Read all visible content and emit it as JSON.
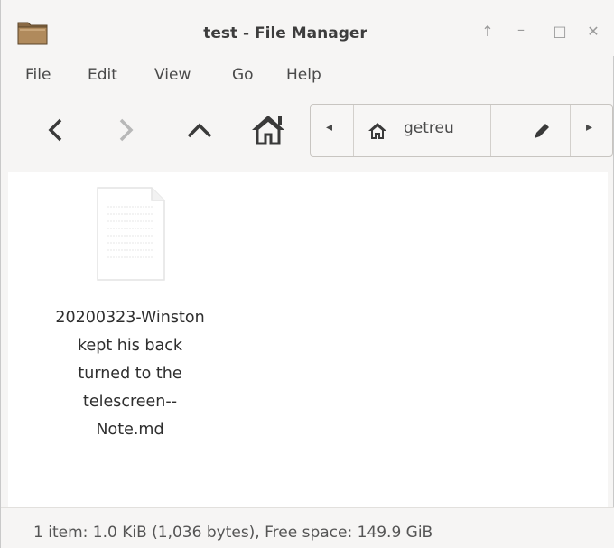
{
  "window": {
    "title": "test - File Manager",
    "controls": [
      "↑",
      "–",
      "□",
      "✕"
    ]
  },
  "menu": {
    "items": [
      "File",
      "Edit",
      "View",
      "Go",
      "Help"
    ]
  },
  "toolbar": {
    "back_icon": "chevron-left-icon",
    "forward_icon": "chevron-right-icon",
    "up_icon": "chevron-up-icon",
    "home_icon": "home-icon"
  },
  "pathbar": {
    "location": "getreu",
    "left_arrow": "◂",
    "right_arrow": "▸",
    "edit_icon": "pencil-icon"
  },
  "files": [
    {
      "name_lines": [
        "20200323-Winston",
        "kept his back",
        "turned to the",
        "telescreen--",
        "Note.md"
      ]
    }
  ],
  "status": {
    "text": "1 item: 1.0 KiB (1,036 bytes), Free space: 149.9 GiB"
  }
}
